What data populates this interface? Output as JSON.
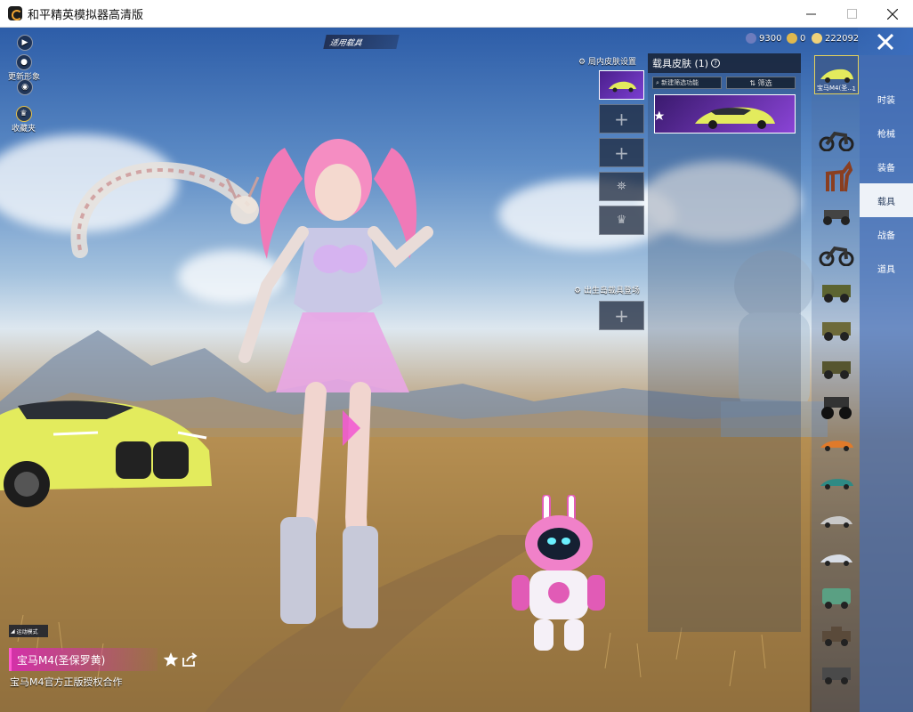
{
  "window": {
    "title": "和平精英模拟器高清版"
  },
  "hud": {
    "top_label": "适用载具",
    "left_buttons": [
      {
        "label": ""
      },
      {
        "label": "更新形象"
      },
      {
        "label": ""
      },
      {
        "label": "收藏夹"
      }
    ]
  },
  "currency": {
    "first": "9300",
    "second": "0",
    "third": "222092"
  },
  "slots": {
    "header": "局内皮肤设置",
    "spawn_header": "出生岛载具登场",
    "add_symbol": "+"
  },
  "skin_panel": {
    "title": "载具皮肤 (1)",
    "search_placeholder": "新建筛选功能",
    "filter_label": "筛选"
  },
  "vehicles": [
    {
      "name": "宝马M4(圣...",
      "count": "1",
      "active": true
    },
    {
      "name": "motorcycle"
    },
    {
      "name": "horse"
    },
    {
      "name": "buggy"
    },
    {
      "name": "motorcycle-2"
    },
    {
      "name": "jeep"
    },
    {
      "name": "uaz"
    },
    {
      "name": "jeep-2"
    },
    {
      "name": "monster-truck"
    },
    {
      "name": "sports-car-orange"
    },
    {
      "name": "sports-car-teal"
    },
    {
      "name": "sedan"
    },
    {
      "name": "coupe"
    },
    {
      "name": "bus"
    },
    {
      "name": "pickup"
    },
    {
      "name": "truck"
    }
  ],
  "tabs": [
    {
      "label": "时装"
    },
    {
      "label": "枪械"
    },
    {
      "label": "装备"
    },
    {
      "label": "载具",
      "active": true
    },
    {
      "label": "战备"
    },
    {
      "label": "道具"
    }
  ],
  "bottom": {
    "mode_badge": "运动模式",
    "item_name": "宝马M4(圣保罗黄)",
    "description": "宝马M4官方正版授权合作"
  },
  "colors": {
    "tab_bg": "#466eb4",
    "active_tab": "#eef2f8",
    "name_bar": "#d331a8",
    "card_purple": "#7a3fd0",
    "car_yellow": "#e4ec5a"
  }
}
